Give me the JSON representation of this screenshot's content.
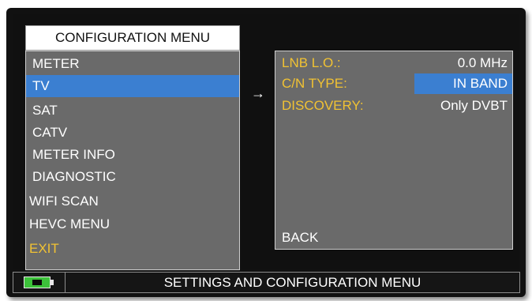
{
  "menu": {
    "title": "CONFIGURATION MENU",
    "items": [
      {
        "label": "METER"
      },
      {
        "label": "TV",
        "selected": true
      },
      {
        "label": "SAT"
      },
      {
        "label": "CATV"
      },
      {
        "label": "METER INFO"
      },
      {
        "label": "DIAGNOSTIC"
      },
      {
        "label": "WIFI SCAN"
      },
      {
        "label": "HEVC MENU"
      },
      {
        "label": "EXIT"
      }
    ]
  },
  "arrow": "→",
  "submenu": {
    "rows": [
      {
        "label": "LNB L.O.:",
        "value": "0.0 MHz"
      },
      {
        "label": "C/N TYPE:",
        "value": "IN BAND",
        "selected": true
      },
      {
        "label": "DISCOVERY:",
        "value": "Only DVBT"
      }
    ],
    "back": "BACK"
  },
  "status": {
    "text": "SETTINGS AND CONFIGURATION MENU",
    "battery_icon": "battery-icon"
  },
  "colors": {
    "accent": "#3b7fd1",
    "label_yellow": "#f1c233",
    "panel_gray": "#6a6a6a",
    "battery_green": "#3cc23a"
  }
}
